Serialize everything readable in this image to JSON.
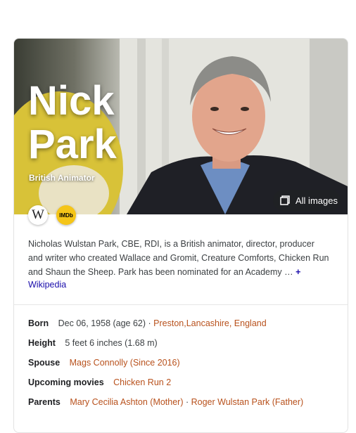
{
  "hero": {
    "name_line1": "Nick",
    "name_line2": "Park",
    "subtitle": "British Animator",
    "all_images_label": "All images"
  },
  "sources": [
    {
      "name": "wikipedia",
      "glyph": "W"
    },
    {
      "name": "imdb",
      "glyph": "IMDb"
    }
  ],
  "description": {
    "text": "Nicholas Wulstan Park, CBE, RDI, is a British animator, director, producer and writer who created Wallace and Gromit, Creature Comforts, Chicken Run and Shaun the Sheep. Park has been nominated for an Academy …",
    "more_symbol": "+",
    "source_link": "Wikipedia"
  },
  "facts": {
    "born": {
      "label": "Born",
      "date": "Dec 06, 1958 (age 62)",
      "sep": " · ",
      "place": "Preston,Lancashire, England"
    },
    "height": {
      "label": "Height",
      "value": "5 feet 6 inches (1.68 m)"
    },
    "spouse": {
      "label": "Spouse",
      "value": "Mags Connolly (Since 2016)"
    },
    "upcoming": {
      "label": "Upcoming movies",
      "value": "Chicken Run 2"
    },
    "parents": {
      "label": "Parents",
      "mother": "Mary Cecilia Ashton (Mother)",
      "sep": " · ",
      "father": "Roger Wulstan Park (Father)"
    }
  },
  "colors": {
    "link_blue": "#1a0dab",
    "fact_link": "#b8511c",
    "imdb_yellow": "#f5c518"
  }
}
